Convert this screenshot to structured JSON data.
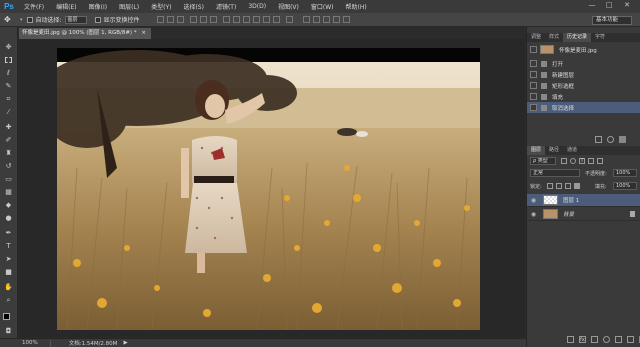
{
  "app": {
    "logo": "Ps"
  },
  "menu": [
    "文件(F)",
    "编辑(E)",
    "图像(I)",
    "图层(L)",
    "类型(Y)",
    "选择(S)",
    "滤镜(T)",
    "3D(D)",
    "视图(V)",
    "窗口(W)",
    "帮助(H)"
  ],
  "window_controls": [
    "—",
    "□",
    "✕"
  ],
  "options": {
    "auto_select_label": "自动选择:",
    "auto_select_value": "图层",
    "show_transform_label": "显示变换控件",
    "workspace": "基本功能"
  },
  "tools": [
    "move-tool",
    "marquee-tool",
    "lasso-tool",
    "quick-select-tool",
    "crop-tool",
    "eyedropper-tool",
    "healing-tool",
    "brush-tool",
    "stamp-tool",
    "history-brush-tool",
    "eraser-tool",
    "gradient-tool",
    "blur-tool",
    "dodge-tool",
    "pen-tool",
    "type-tool",
    "path-select-tool",
    "shape-tool",
    "hand-tool",
    "zoom-tool"
  ],
  "document": {
    "tab_title": "怀像是麦田.jpg @ 100% (图层 1, RGB/8#) *",
    "tab_close": "×"
  },
  "status": {
    "zoom": "100%",
    "doc_info": "文档:1.54M/2.80M",
    "arrow": "▶"
  },
  "history_panel": {
    "tabs": [
      "调整",
      "样式",
      "历史记录",
      "字符"
    ],
    "active_tab_index": 2,
    "snapshot_name": "怀像是麦田.jpg",
    "steps": [
      "打开",
      "新建图层",
      "矩形选框",
      "填充",
      "取消选择"
    ],
    "selected_step_index": 4
  },
  "layers_panel": {
    "tabs": [
      "图层",
      "路径",
      "通道"
    ],
    "active_tab_index": 0,
    "filter_label": "ρ 类型",
    "blend_mode": "正常",
    "opacity_label": "不透明度:",
    "opacity_value": "100%",
    "lock_label": "锁定:",
    "fill_label": "填充:",
    "fill_value": "100%",
    "layers": [
      {
        "name": "图层 1",
        "selected": true
      },
      {
        "name": "背景",
        "selected": false,
        "locked": true
      }
    ]
  },
  "colors": {
    "accent_selected": "#4b5d7a",
    "photoshop_blue": "#31a8ff"
  }
}
